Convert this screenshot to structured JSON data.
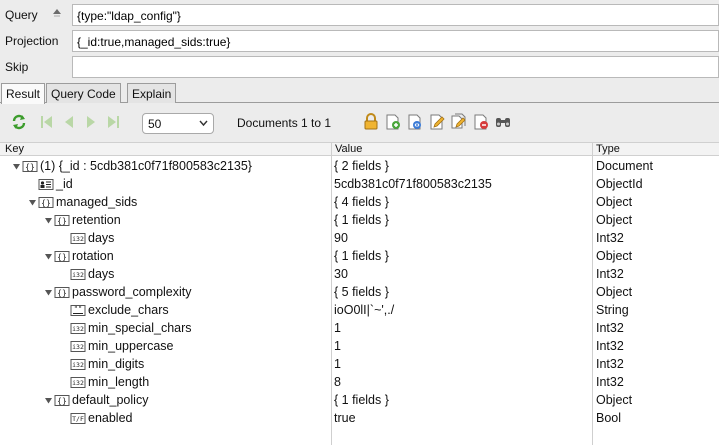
{
  "query_bar": {
    "query_label": "Query",
    "query_value": "{type:\"ldap_config\"}",
    "projection_label": "Projection",
    "projection_value": "{_id:true,managed_sids:true}",
    "skip_label": "Skip",
    "skip_value": ""
  },
  "tabs": [
    {
      "label": "Result",
      "active": true
    },
    {
      "label": "Query Code",
      "active": false
    },
    {
      "label": "Explain",
      "active": false
    }
  ],
  "toolbar": {
    "page_size": "50",
    "documents_label": "Documents 1 to 1"
  },
  "columns": {
    "key": "Key",
    "value": "Value",
    "type": "Type"
  },
  "rows": [
    {
      "key": "(1) {_id : 5cdb381c0f71f800583c2135}",
      "value": "{ 2 fields }",
      "type": "Document",
      "icon": "object-icon"
    },
    {
      "key": "_id",
      "value": "5cdb381c0f71f800583c2135",
      "type": "ObjectId",
      "icon": "objectid-icon"
    },
    {
      "key": "managed_sids",
      "value": "{ 4 fields }",
      "type": "Object",
      "icon": "object-icon"
    },
    {
      "key": "retention",
      "value": "{ 1 fields }",
      "type": "Object",
      "icon": "object-icon"
    },
    {
      "key": "days",
      "value": "90",
      "type": "Int32",
      "icon": "int32-icon"
    },
    {
      "key": "rotation",
      "value": "{ 1 fields }",
      "type": "Object",
      "icon": "object-icon"
    },
    {
      "key": "days",
      "value": "30",
      "type": "Int32",
      "icon": "int32-icon"
    },
    {
      "key": "password_complexity",
      "value": "{ 5 fields }",
      "type": "Object",
      "icon": "object-icon"
    },
    {
      "key": "exclude_chars",
      "value": "ioO0lI|`~',./",
      "type": "String",
      "icon": "string-icon"
    },
    {
      "key": "min_special_chars",
      "value": "1",
      "type": "Int32",
      "icon": "int32-icon"
    },
    {
      "key": "min_uppercase",
      "value": "1",
      "type": "Int32",
      "icon": "int32-icon"
    },
    {
      "key": "min_digits",
      "value": "1",
      "type": "Int32",
      "icon": "int32-icon"
    },
    {
      "key": "min_length",
      "value": "8",
      "type": "Int32",
      "icon": "int32-icon"
    },
    {
      "key": "default_policy",
      "value": "{ 1 fields }",
      "type": "Object",
      "icon": "object-icon"
    },
    {
      "key": "enabled",
      "value": "true",
      "type": "Bool",
      "icon": "bool-icon"
    }
  ]
}
